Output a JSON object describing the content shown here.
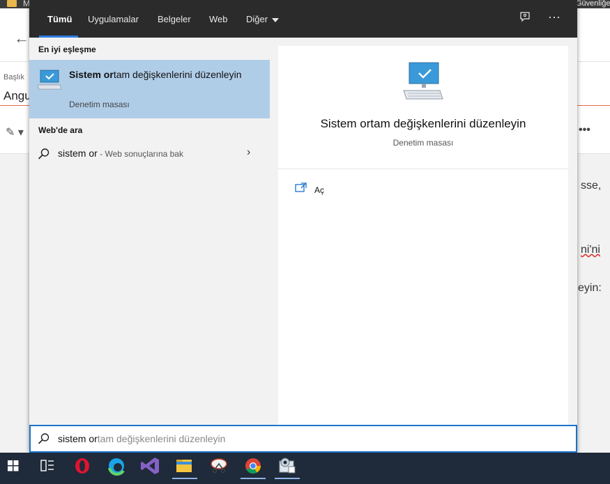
{
  "background": {
    "topbar_text": "M",
    "topbar_right": "Güvenliğe",
    "back_glyph": "←",
    "field_label": "Başlık",
    "field_value": "Angu",
    "pen_glyph": "✎ ▾",
    "more_glyph": "•••",
    "text_lines": [
      "sse,",
      "ni'ni",
      "eyin:"
    ]
  },
  "nav": {
    "tabs": [
      "Tümü",
      "Uygulamalar",
      "Belgeler",
      "Web",
      "Diğer"
    ],
    "active_tab": "Tümü",
    "feedback_icon": "feedback-icon",
    "more_options": "···"
  },
  "best_match": {
    "section_label": "En iyi eşleşme",
    "title_bold": "Sistem or",
    "title_rest": "tam değişkenlerini düzenleyin",
    "subtitle": "Denetim masası"
  },
  "web_search": {
    "section_label": "Web'de ara",
    "query": "sistem or",
    "hint": " - Web sonuçlarına bak",
    "chevron": "›"
  },
  "preview": {
    "title": "Sistem ortam değişkenlerini düzenleyin",
    "subtitle": "Denetim masası",
    "open_label": "Aç"
  },
  "search_box": {
    "typed": "sistem or",
    "autocomplete": "tam değişkenlerini düzenleyin"
  },
  "taskbar": {
    "items": [
      "start-icon",
      "task-view-icon",
      "opera-icon",
      "edge-icon",
      "visual-studio-icon",
      "file-explorer-icon",
      "snipping-tool-icon",
      "chrome-icon",
      "control-panel-icon"
    ],
    "colors": {
      "background": "#1f2a3a",
      "accent": "#1a73c9",
      "selection": "#b0cde8"
    }
  }
}
